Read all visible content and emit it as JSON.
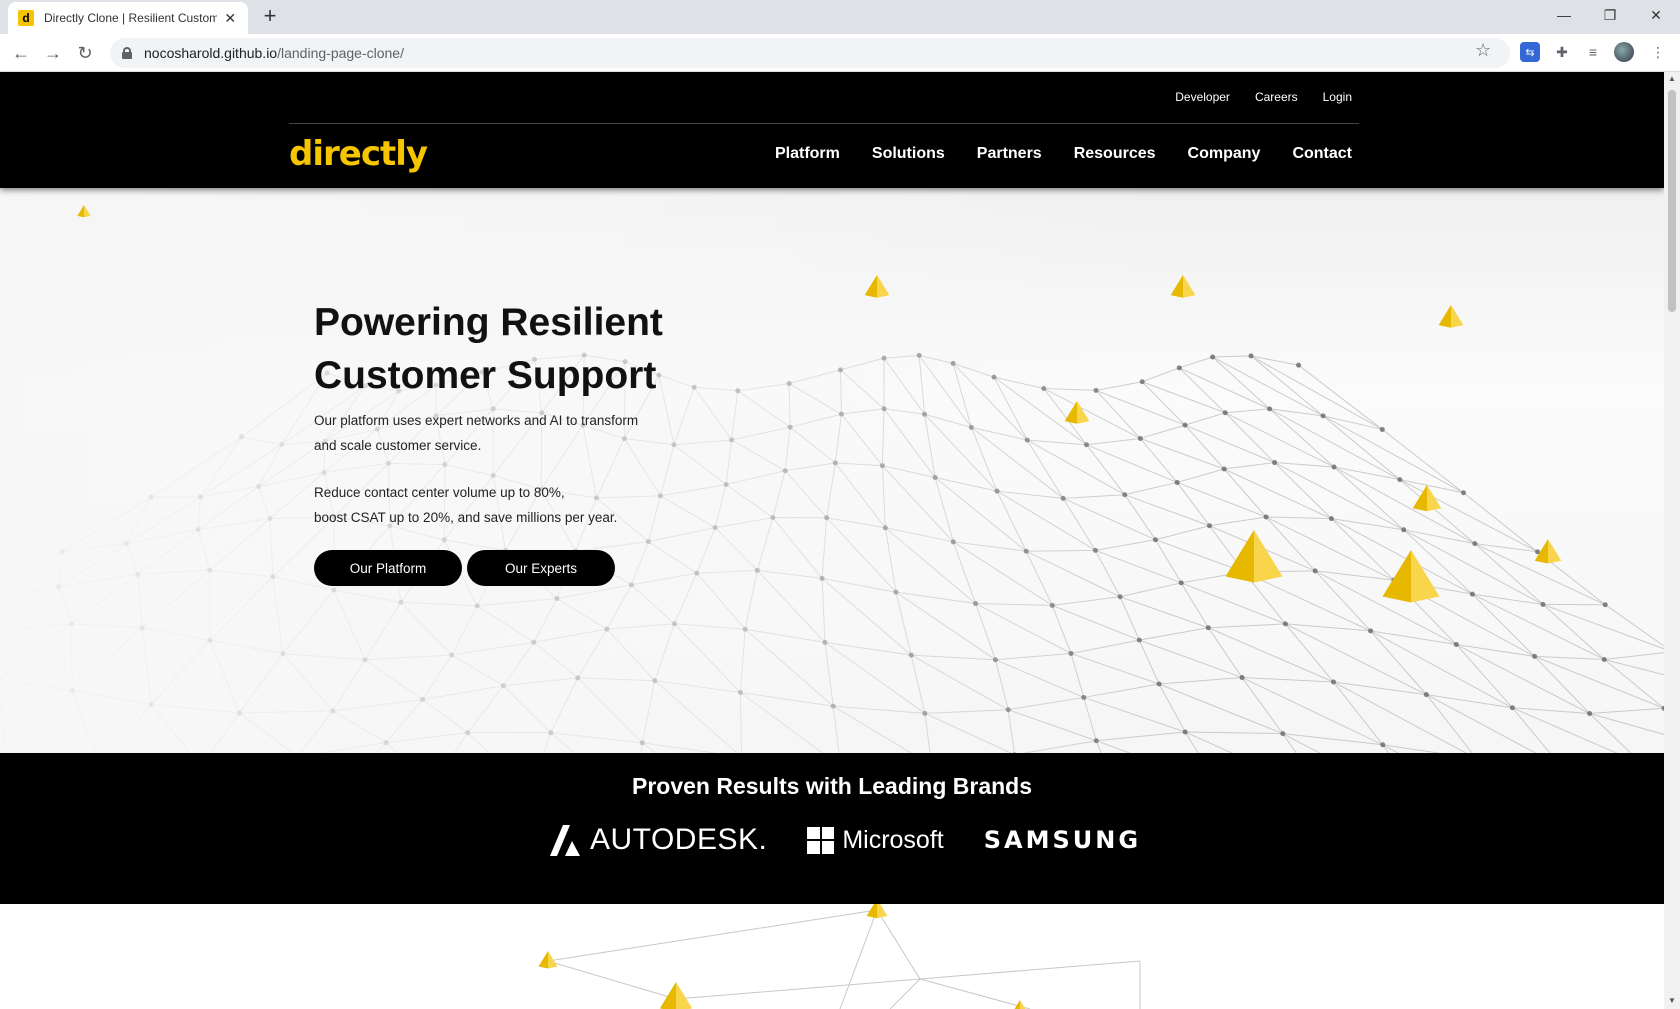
{
  "browser": {
    "tab_title": "Directly Clone | Resilient Customer Support",
    "favicon_letter": "d",
    "url_host": "nocosharold.github.io",
    "url_path": "/landing-page-clone/"
  },
  "header": {
    "top_links": [
      "Developer",
      "Careers",
      "Login"
    ],
    "logo": "directly",
    "nav": [
      "Platform",
      "Solutions",
      "Partners",
      "Resources",
      "Company",
      "Contact"
    ]
  },
  "hero": {
    "title_line1": "Powering Resilient",
    "title_line2": "Customer Support",
    "desc_line1": "Our platform uses expert networks and AI to transform",
    "desc_line2": "and scale customer service.",
    "stat_line1": "Reduce contact center volume up to 80%,",
    "stat_line2": "boost CSAT up to 20%, and save millions per year.",
    "btn_platform": "Our Platform",
    "btn_experts": "Our Experts"
  },
  "brands": {
    "title": "Proven Results with Leading Brands",
    "autodesk": "AUTODESK.",
    "microsoft": "Microsoft",
    "samsung": "SAMSUNG"
  },
  "colors": {
    "accent": "#f5c500",
    "header_bg": "#000000",
    "button_bg": "#000000"
  }
}
